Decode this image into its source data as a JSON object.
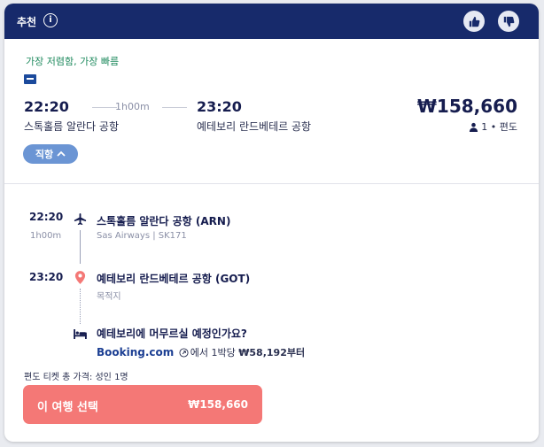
{
  "header": {
    "label": "추천",
    "info_glyph": "i",
    "info_icon": "info-icon",
    "thumbs_up_icon": "thumbs-up-icon",
    "thumbs_down_icon": "thumbs-down-icon",
    "bg_color": "#172a6b"
  },
  "summary": {
    "tag": "가장 저렴함, 가장 빠름",
    "tag_color": "#1f8a5e",
    "airline_logo": "sas-logo",
    "departure_time": "22:20",
    "arrival_time": "23:20",
    "duration": "1h00m",
    "departure_airport": "스톡홀름 알란다 공항",
    "arrival_airport": "예테보리 란드베테르 공항",
    "price": "₩158,660",
    "passengers": "1",
    "separator": "•",
    "trip_type": "편도",
    "direct_label": "직항",
    "direct_color": "#6b95d4"
  },
  "details": {
    "segment_departure_time": "22:20",
    "segment_duration": "1h00m",
    "segment_departure_airport": "스톡홀름 알란다 공항 (ARN)",
    "segment_carrier": "Sas Airways | SK171",
    "segment_arrival_time": "23:20",
    "segment_arrival_airport": "예테보리 란드베테르 공항 (GOT)",
    "destination_label": "목적지",
    "stay_question": "예테보리에 머무르실 예정인가요?",
    "booking_brand": "Booking.com",
    "booking_text_mid": "에서 1박당",
    "booking_price": "₩58,192부터"
  },
  "footer": {
    "total_label": "편도 티켓 총 가격: 성인 1명",
    "select_label": "이 여행 선택",
    "select_price": "₩158,660",
    "select_color": "#f47876"
  }
}
